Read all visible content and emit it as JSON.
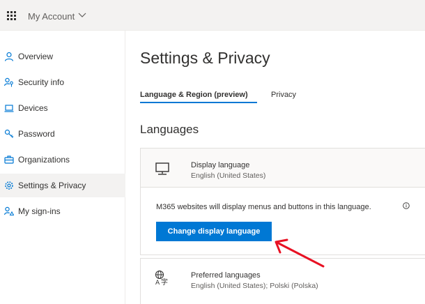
{
  "topbar": {
    "app_name": "My Account",
    "waffle_icon": "waffle-icon",
    "chevron_icon": "chevron-down-icon"
  },
  "sidebar": {
    "items": [
      {
        "label": "Overview",
        "icon": "person-icon",
        "active": false
      },
      {
        "label": "Security info",
        "icon": "key-person-icon",
        "active": false
      },
      {
        "label": "Devices",
        "icon": "laptop-icon",
        "active": false
      },
      {
        "label": "Password",
        "icon": "key-icon",
        "active": false
      },
      {
        "label": "Organizations",
        "icon": "briefcase-icon",
        "active": false
      },
      {
        "label": "Settings & Privacy",
        "icon": "gear-icon",
        "active": true
      },
      {
        "label": "My sign-ins",
        "icon": "sign-ins-icon",
        "active": false
      }
    ]
  },
  "main": {
    "title": "Settings & Privacy",
    "tabs": [
      {
        "label": "Language & Region (preview)",
        "active": true
      },
      {
        "label": "Privacy",
        "active": false
      }
    ],
    "section_title": "Languages",
    "display_language": {
      "icon": "monitor-icon",
      "title": "Display language",
      "value": "English (United States)",
      "description": "M365 websites will display menus and buttons in this language.",
      "info_icon": "info-icon",
      "button_label": "Change display language"
    },
    "preferred_languages": {
      "icon": "language-icon",
      "title": "Preferred languages",
      "value": "English (United States); Polski (Polska)"
    }
  },
  "colors": {
    "accent": "#0078d4",
    "sidebar_active": "#f3f2f1",
    "topbar": "#f3f2f1",
    "annotation": "#e81123"
  }
}
